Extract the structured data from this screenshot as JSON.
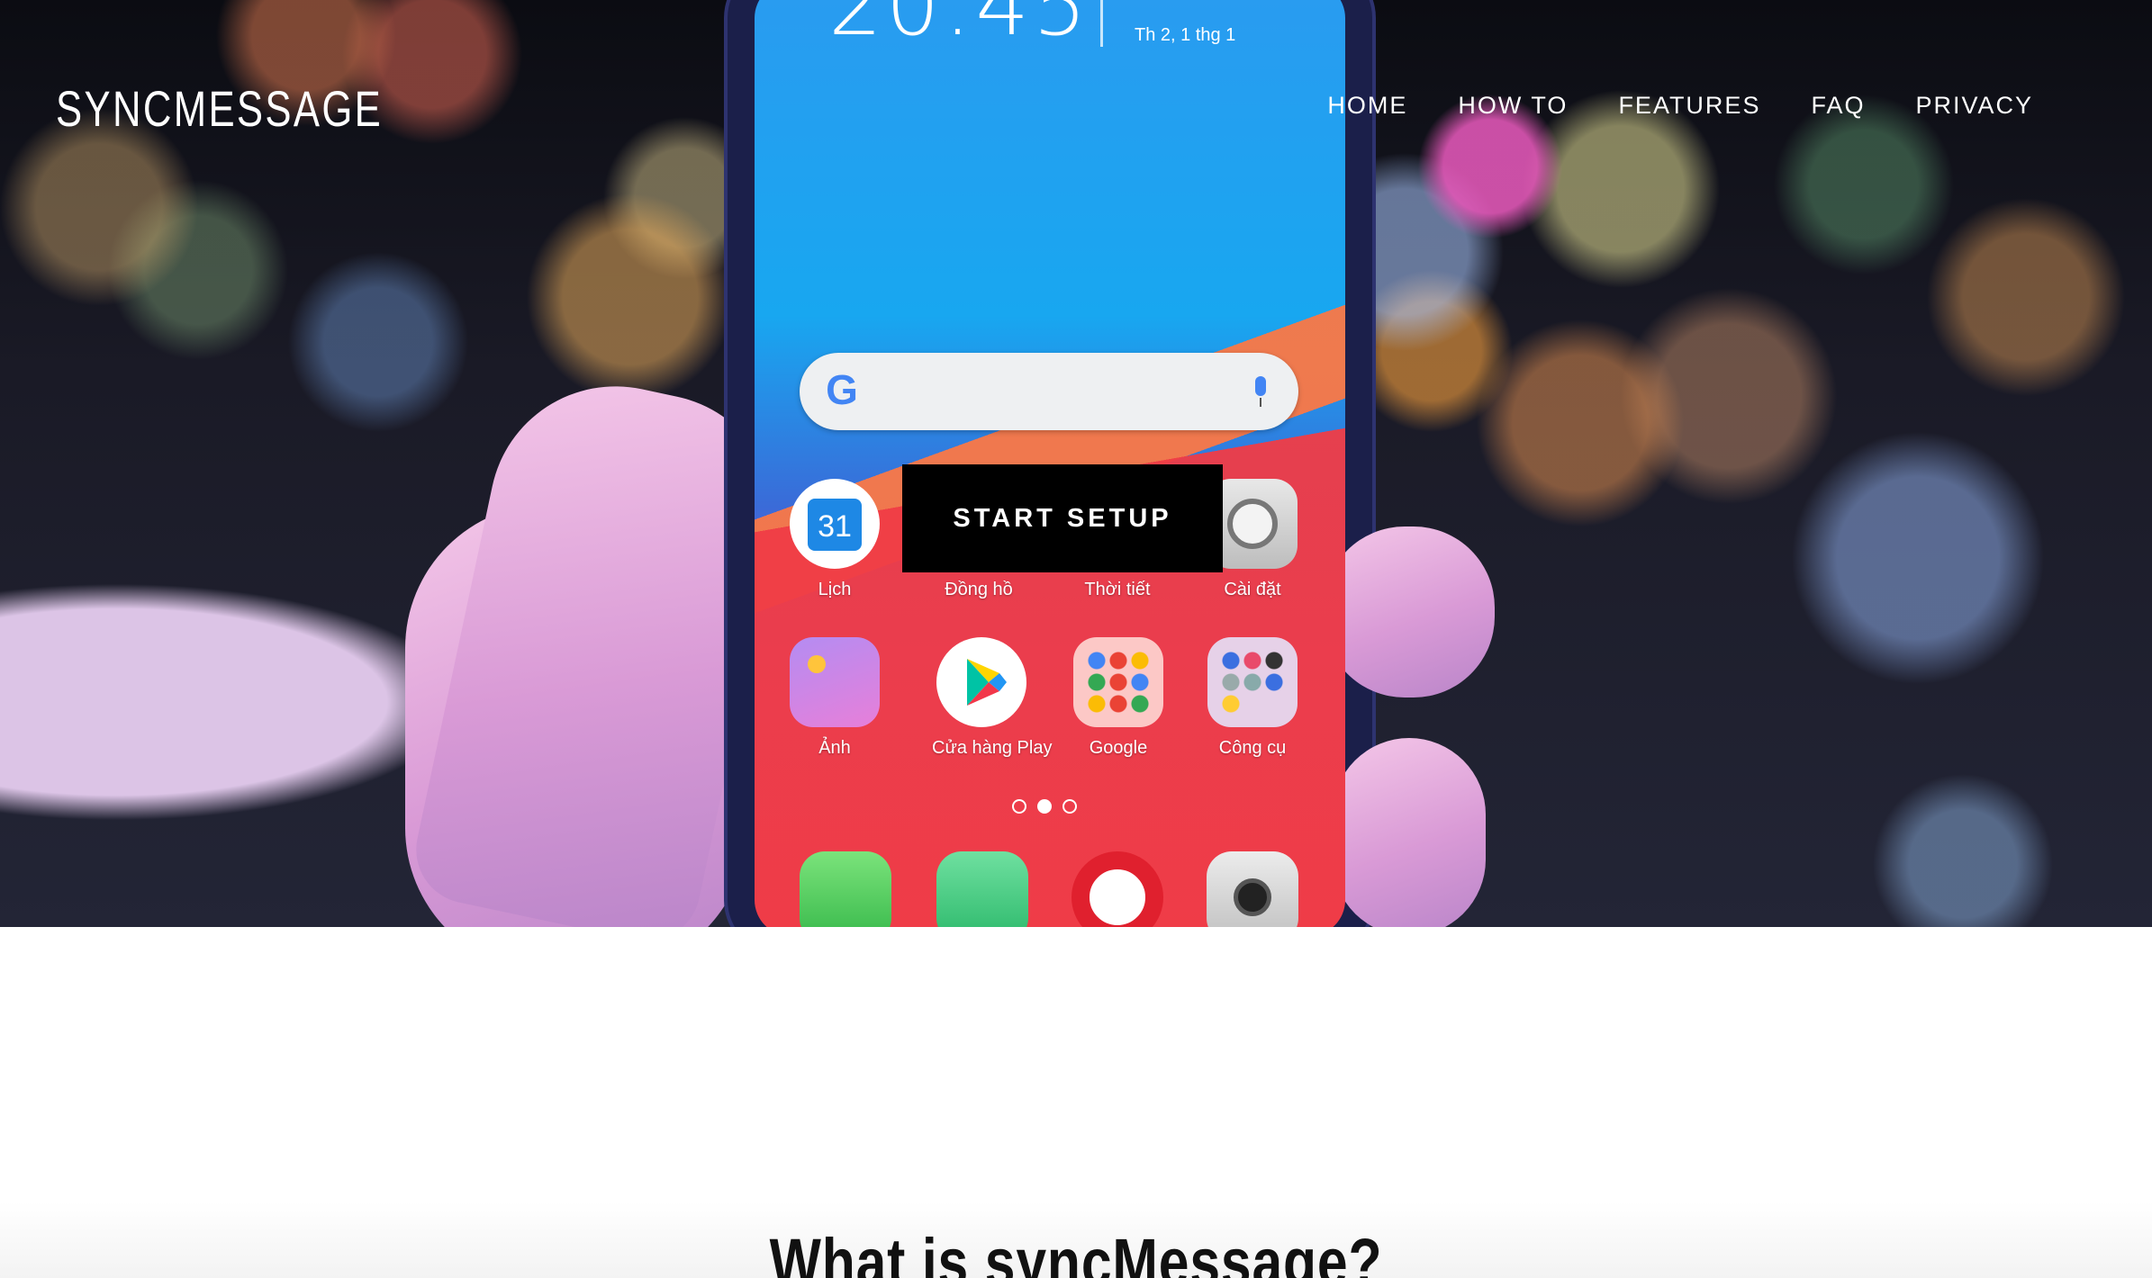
{
  "brand": {
    "name": "SYNCMESSAGE"
  },
  "nav": {
    "items": [
      {
        "label": "HOME"
      },
      {
        "label": "HOW TO"
      },
      {
        "label": "FEATURES"
      },
      {
        "label": "FAQ"
      },
      {
        "label": "PRIVACY"
      }
    ]
  },
  "hero": {
    "cta_label": "START SETUP",
    "phone": {
      "clock": "20:45",
      "date": "Th 2, 1 thg 1",
      "apps_row1": [
        {
          "label": "Lịch",
          "icon": "calendar-icon",
          "badge": "31"
        },
        {
          "label": "Đồng hồ",
          "icon": "clock-icon"
        },
        {
          "label": "Thời tiết",
          "icon": "weather-icon"
        },
        {
          "label": "Cài đặt",
          "icon": "settings-icon"
        }
      ],
      "apps_row2": [
        {
          "label": "Ảnh",
          "icon": "photos-icon"
        },
        {
          "label": "Cửa hàng Play",
          "icon": "play-store-icon"
        },
        {
          "label": "Google",
          "icon": "google-folder-icon"
        },
        {
          "label": "Công cụ",
          "icon": "tools-folder-icon"
        }
      ],
      "dock": [
        "phone-icon",
        "messages-icon",
        "opera-icon",
        "camera-icon"
      ]
    }
  },
  "about": {
    "title": "What is syncMessage?"
  },
  "colors": {
    "cta_bg": "#000000",
    "text_light": "#ffffff"
  }
}
